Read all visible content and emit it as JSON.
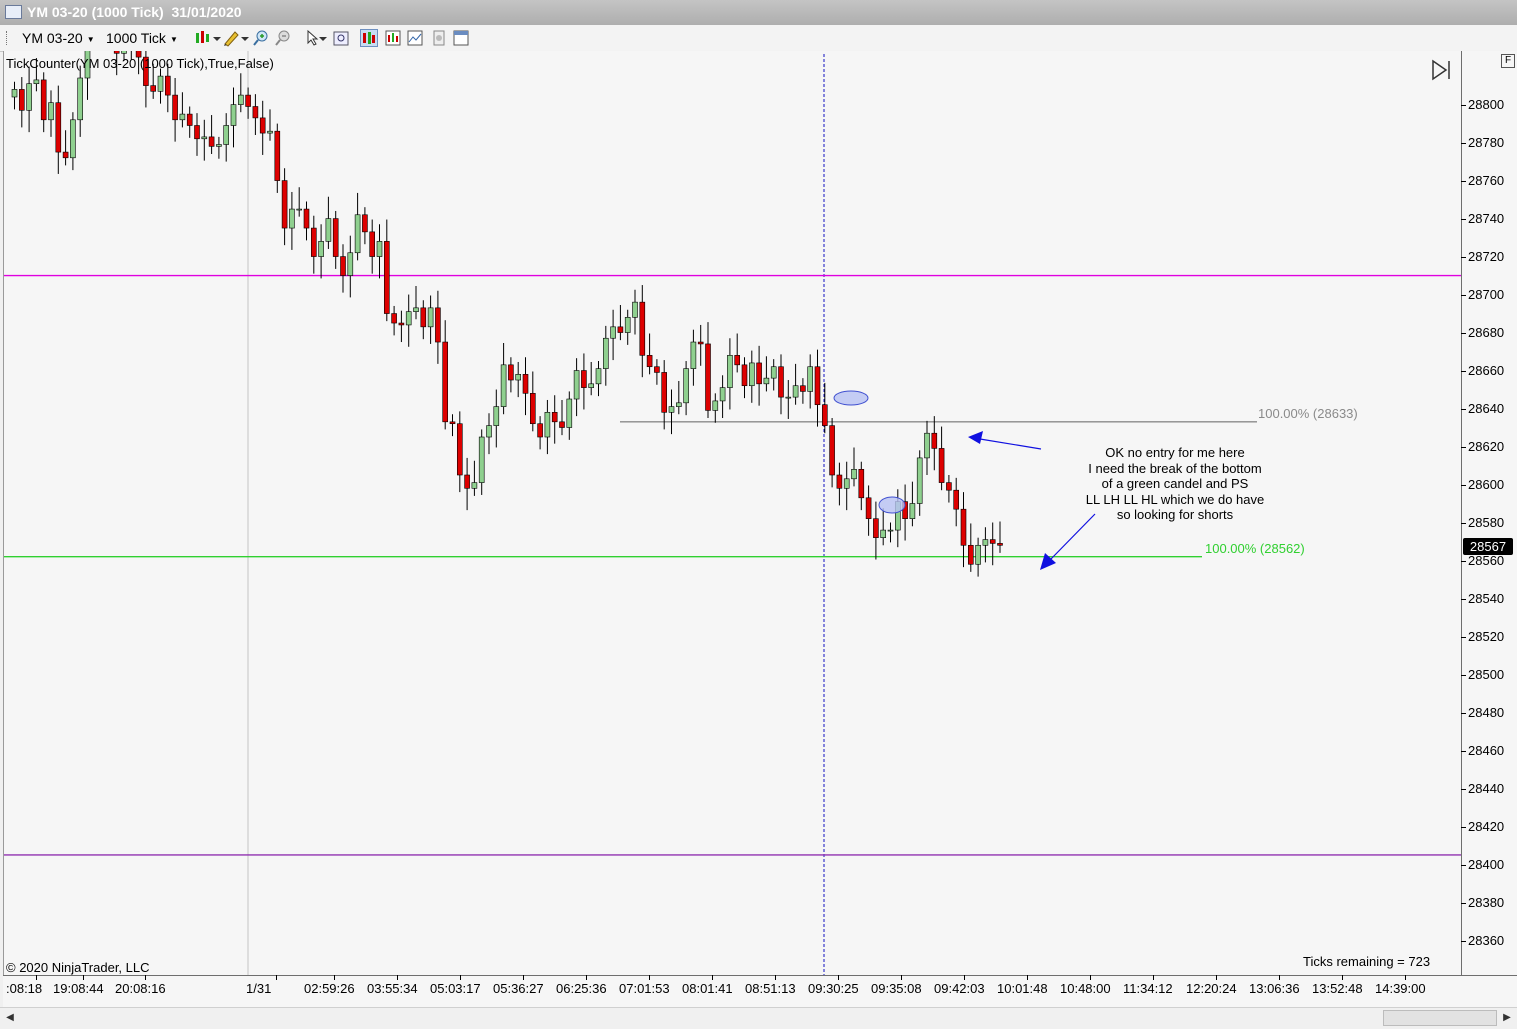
{
  "window": {
    "title": "YM 03-20 (1000 Tick)  31/01/2020"
  },
  "toolbar": {
    "instrument": "YM 03-20",
    "interval": "1000 Tick",
    "icons": [
      "bar-type-icon",
      "drawing-tool-icon",
      "zoom-in-icon",
      "zoom-out-icon",
      "pointer-icon",
      "data-box-icon",
      "chart-style-icon",
      "strategies-icon",
      "templates-icon",
      "properties-icon",
      "panel-icon"
    ]
  },
  "chart": {
    "indicator_label": "TickCounter(YM 03-20 (1000 Tick),True,False)",
    "copyright": "© 2020 NinjaTrader, LLC",
    "ticks_remaining": "Ticks remaining = 723",
    "last_price": "28567",
    "y_ticks": [
      "28800",
      "28780",
      "28760",
      "28740",
      "28720",
      "28700",
      "28680",
      "28660",
      "28640",
      "28620",
      "28600",
      "28580",
      "28560",
      "28540",
      "28520",
      "28500",
      "28480",
      "28460",
      "28440",
      "28420",
      "28400",
      "28380",
      "28360"
    ],
    "x_ticks": [
      ":08:18",
      "19:08:44",
      "20:08:16",
      "1/31",
      "02:59:26",
      "03:55:34",
      "05:03:17",
      "05:36:27",
      "06:25:36",
      "07:01:53",
      "08:01:41",
      "08:51:13",
      "09:30:25",
      "09:35:08",
      "09:42:03",
      "10:01:48",
      "10:48:00",
      "11:34:12",
      "12:20:24",
      "13:06:36",
      "13:52:48",
      "14:39:00"
    ],
    "fib_top_label": "100.00% (28633)",
    "fib_bottom_label": "100.00% (28562)",
    "annotation_lines": [
      "OK no entry for me here",
      "I need the break of the bottom",
      "of a green candel and PS",
      "LL LH LL HL which we do have",
      "so looking for shorts"
    ],
    "panel_button": "F",
    "colors": {
      "up_candle": "#8fd08f",
      "down_candle": "#dd0000",
      "magenta_line": "#e000e0",
      "purple_line": "#9030b0",
      "green_line": "#30d030",
      "grey_fib": "#8a8a8a",
      "vertical_dashed": "#1010c0",
      "arrow": "#1010e0",
      "ellipse": "#9aaaf0"
    },
    "horizontal_lines": [
      28710,
      28405
    ],
    "fib_levels": [
      28633,
      28562
    ]
  }
}
